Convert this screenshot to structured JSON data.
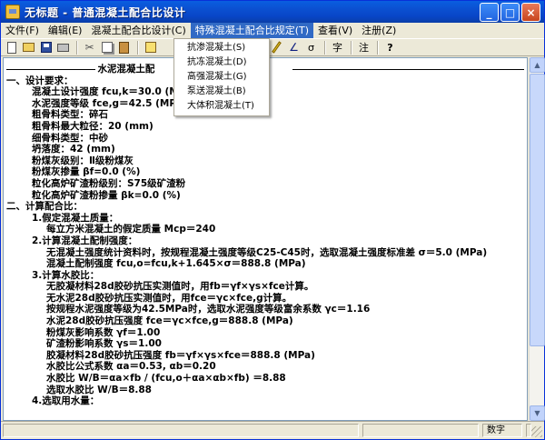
{
  "window": {
    "title": "无标题 - 普通混凝土配合比设计",
    "minimize_glyph": "_",
    "maximize_glyph": "□",
    "close_glyph": "×"
  },
  "menubar": {
    "items": [
      "文件(F)",
      "编辑(E)",
      "混凝土配合比设计(C)",
      "特殊混凝土配合比规定(T)",
      "查看(V)",
      "注册(Z)"
    ],
    "active_index": 3
  },
  "dropdown": {
    "items": [
      "抗渗混凝土(S)",
      "抗冻混凝土(D)",
      "高强混凝土(G)",
      "泵送混凝土(B)",
      "大体积混凝土(T)"
    ]
  },
  "toolbar": {
    "icons": [
      "new-icon",
      "open-icon",
      "save-icon",
      "print-icon",
      "cut-icon",
      "copy-icon",
      "paste-icon",
      "shape-icon",
      "pencil-icon",
      "angle-icon",
      "sigma-icon",
      "font-icon",
      "note-icon",
      "help-icon"
    ],
    "sigma_label": "σ",
    "font_label": "字",
    "note_label": "注",
    "help_label": "?"
  },
  "document": {
    "heading": "水泥混凝土配",
    "lines": [
      {
        "indent": 0,
        "text": "一、设计要求："
      },
      {
        "indent": 1,
        "text": "混凝土设计强度 fcu,k＝30.0 (MPa)"
      },
      {
        "indent": 1,
        "text": "水泥强度等级 fce,g＝42.5 (MPa)"
      },
      {
        "indent": 1,
        "text": "粗骨料类型：碎石"
      },
      {
        "indent": 1,
        "text": "粗骨料最大粒径：20 (mm)"
      },
      {
        "indent": 1,
        "text": "细骨料类型：中砂"
      },
      {
        "indent": 1,
        "text": "坍落度：42 (mm)"
      },
      {
        "indent": 1,
        "text": "粉煤灰级别：Ⅱ级粉煤灰"
      },
      {
        "indent": 1,
        "text": "粉煤灰掺量 βf=0.0 (%)"
      },
      {
        "indent": 1,
        "text": "粒化高炉矿渣粉级别：S75级矿渣粉"
      },
      {
        "indent": 1,
        "text": "粒化高炉矿渣粉掺量 βk=0.0 (%)"
      },
      {
        "indent": 0,
        "text": "二、计算配合比："
      },
      {
        "indent": 2,
        "text": "1.假定混凝土质量："
      },
      {
        "indent": 3,
        "text": "每立方米混凝土的假定质量 Mcp＝240"
      },
      {
        "indent": 2,
        "text": "2.计算混凝土配制强度："
      },
      {
        "indent": 3,
        "text": "无混凝土强度统计资料时，按规程混凝土强度等级C25-C45时，选取混凝土强度标准差 σ＝5.0 (MPa)"
      },
      {
        "indent": 3,
        "text": "混凝土配制强度 fcu,o=fcu,k+1.645×σ＝888.8 (MPa)"
      },
      {
        "indent": 2,
        "text": "3.计算水胶比："
      },
      {
        "indent": 3,
        "text": "无胶凝材料28d胶砂抗压实测值时，用fb＝γf×γs×fce计算。"
      },
      {
        "indent": 3,
        "text": "无水泥28d胶砂抗压实测值时，用fce＝γc×fce,g计算。"
      },
      {
        "indent": 3,
        "text": "按规程水泥强度等级为42.5MPa时，选取水泥强度等级富余系数 γc＝1.16"
      },
      {
        "indent": 3,
        "text": "水泥28d胶砂抗压强度 fce＝γc×fce,g＝888.8 (MPa)"
      },
      {
        "indent": 3,
        "text": "粉煤灰影响系数 γf＝1.00"
      },
      {
        "indent": 3,
        "text": "矿渣粉影响系数 γs＝1.00"
      },
      {
        "indent": 3,
        "text": "胶凝材料28d胶砂抗压强度 fb＝γf×γs×fce＝888.8 (MPa)"
      },
      {
        "indent": 3,
        "text": "水胶比公式系数 αa＝0.53, αb＝0.20"
      },
      {
        "indent": 3,
        "text": "水胶比 W/B＝αa×fb / (fcu,o＋αa×αb×fb) ＝8.88"
      },
      {
        "indent": 3,
        "text": "选取水胶比 W/B＝8.88"
      },
      {
        "indent": 2,
        "text": "4.选取用水量："
      }
    ]
  },
  "statusbar": {
    "mode": "数字"
  }
}
